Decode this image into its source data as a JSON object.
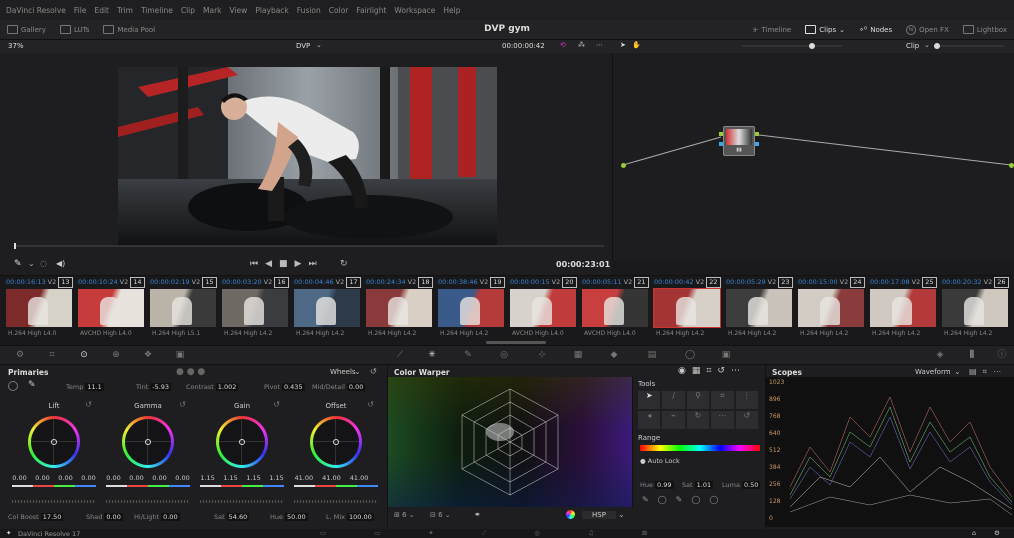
{
  "menu": [
    "DaVinci Resolve",
    "File",
    "Edit",
    "Trim",
    "Timeline",
    "Clip",
    "Mark",
    "View",
    "Playback",
    "Fusion",
    "Color",
    "Fairlight",
    "Workspace",
    "Help"
  ],
  "toolbar": {
    "gallery": "Gallery",
    "luts": "LUTs",
    "media_pool": "Media Pool",
    "project": "DVP gym",
    "timeline": "Timeline",
    "clips": "Clips",
    "nodes": "Nodes",
    "openfx": "Open FX",
    "lightbox": "Lightbox"
  },
  "viewer": {
    "zoom": "37%",
    "timeline_name": "DVP",
    "timecode": "00:00:00:42",
    "duration": "00:00:23:01",
    "clip_mode": "Clip"
  },
  "clips": [
    {
      "tc": "00:00:16:13",
      "track": "V2",
      "num": "13",
      "codec": "H.264 High L4.0",
      "c1": "#7d2a2a",
      "c2": "#d7d2c8"
    },
    {
      "tc": "00:00:10:24",
      "track": "V2",
      "num": "14",
      "codec": "AVCHD High L4.0",
      "c1": "#c63c3c",
      "c2": "#e7e2dc"
    },
    {
      "tc": "00:00:02:19",
      "track": "V2",
      "num": "15",
      "codec": "H.264 High L5.1",
      "c1": "#b9b3a8",
      "c2": "#3a3a3a"
    },
    {
      "tc": "00:00:03:20",
      "track": "V2",
      "num": "16",
      "codec": "H.264 High L4.2",
      "c1": "#6e6a63",
      "c2": "#3a3c40"
    },
    {
      "tc": "00:00:04:46",
      "track": "V2",
      "num": "17",
      "codec": "H.264 High L4.2",
      "c1": "#4d6985",
      "c2": "#2c3a4a"
    },
    {
      "tc": "00:00:24:34",
      "track": "V2",
      "num": "18",
      "codec": "H.264 High L4.2",
      "c1": "#8a3a3a",
      "c2": "#d9cfc5"
    },
    {
      "tc": "00:00:38:46",
      "track": "V2",
      "num": "19",
      "codec": "H.264 High L4.2",
      "c1": "#3a5a8a",
      "c2": "#b53a3a"
    },
    {
      "tc": "00:00:00:15",
      "track": "V2",
      "num": "20",
      "codec": "AVCHD High L4.0",
      "c1": "#d7d2cc",
      "c2": "#c03b3b"
    },
    {
      "tc": "00:00:05:11",
      "track": "V2",
      "num": "21",
      "codec": "AVCHD High L4.0",
      "c1": "#c93f3f",
      "c2": "#353535"
    },
    {
      "tc": "00:00:00:42",
      "track": "V2",
      "num": "22",
      "codec": "H.264 High L4.2",
      "c1": "#a33535",
      "c2": "#d6d0c9"
    },
    {
      "tc": "00:00:05:29",
      "track": "V2",
      "num": "23",
      "codec": "H.264 High L4.2",
      "c1": "#3d3d3d",
      "c2": "#c9c3bb"
    },
    {
      "tc": "00:00:15:00",
      "track": "V2",
      "num": "24",
      "codec": "H.264 High L4.2",
      "c1": "#d2ccc4",
      "c2": "#8a3c3c"
    },
    {
      "tc": "00:00:17:08",
      "track": "V2",
      "num": "25",
      "codec": "H.264 High L4.2",
      "c1": "#cfc9c1",
      "c2": "#b33a3a"
    },
    {
      "tc": "00:00:20:32",
      "track": "V2",
      "num": "26",
      "codec": "H.264 High L4.2",
      "c1": "#3a3a3a",
      "c2": "#cec8bf"
    }
  ],
  "primaries": {
    "title": "Primaries",
    "mode": "Wheels",
    "temp_label": "Temp",
    "temp": "11.1",
    "tint_label": "Tint",
    "tint": "-5.93",
    "contrast_label": "Contrast",
    "contrast": "1.002",
    "pivot_label": "Pivot",
    "pivot": "0.435",
    "middetail_label": "Mid/Detail",
    "middetail": "0.00",
    "wheels": [
      {
        "name": "Lift",
        "values": [
          "0.00",
          "0.00",
          "0.00",
          "0.00"
        ]
      },
      {
        "name": "Gamma",
        "values": [
          "0.00",
          "0.00",
          "0.00",
          "0.00"
        ]
      },
      {
        "name": "Gain",
        "values": [
          "1.15",
          "1.15",
          "1.15",
          "1.15"
        ]
      },
      {
        "name": "Offset",
        "values": [
          "41.00",
          "41.00",
          "41.00",
          ""
        ]
      }
    ],
    "colboost_label": "Col Boost",
    "colboost": "17.50",
    "shad_label": "Shad",
    "shad": "0.00",
    "hilight_label": "Hi/Light",
    "hilight": "0.00",
    "sat_label": "Sat",
    "sat": "54.60",
    "hue_label": "Hue",
    "hue": "50.00",
    "lmix_label": "L. Mix",
    "lmix": "100.00"
  },
  "warper": {
    "title": "Color Warper",
    "tools_label": "Tools",
    "range_label": "Range",
    "auto_lock": "Auto Lock",
    "hue_label": "Hue",
    "hue": "0.99",
    "sat_label": "Sat",
    "sat": "1.01",
    "luma_label": "Luma",
    "luma": "0.50",
    "col1": "6",
    "col2": "6",
    "mode": "HSP"
  },
  "scopes": {
    "title": "Scopes",
    "mode": "Waveform",
    "ticks": [
      "1023",
      "896",
      "768",
      "640",
      "512",
      "384",
      "256",
      "128",
      "0"
    ]
  },
  "status": {
    "app": "DaVinci Resolve 17"
  }
}
